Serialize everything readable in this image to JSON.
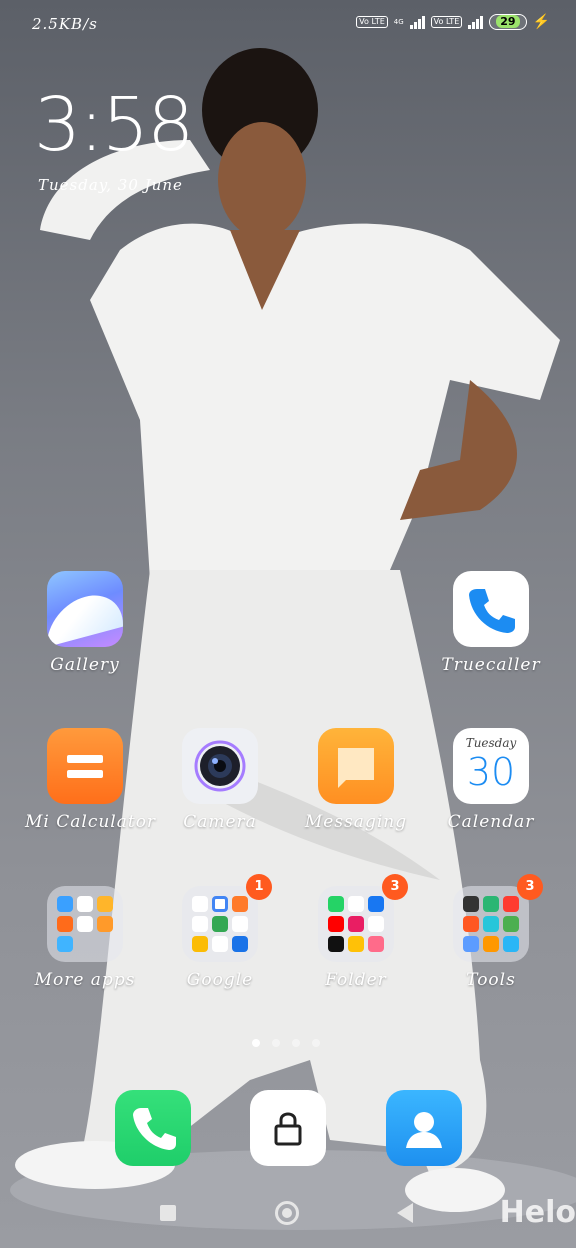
{
  "status_bar": {
    "network_speed": "2.5KB/s",
    "sim1_label": "Vo LTE",
    "network_type": "4G",
    "sim2_label": "Vo LTE",
    "battery_level": "29"
  },
  "lockclock": {
    "time": "3:58",
    "date": "Tuesday, 30 June"
  },
  "apps": {
    "gallery": "Gallery",
    "truecaller": "Truecaller",
    "mi_calculator": "Mi Calculator",
    "camera": "Camera",
    "messaging": "Messaging",
    "calendar": "Calendar",
    "calendar_day": "Tuesday",
    "calendar_date": "30",
    "more_apps": "More apps",
    "google": "Google",
    "google_badge": "1",
    "folder": "Folder",
    "folder_badge": "3",
    "tools": "Tools",
    "tools_badge": "3"
  },
  "page_indicator": {
    "pages": 4,
    "current": 1
  },
  "watermark": "Helo",
  "colors": {
    "accent_badge": "#ff5a1f",
    "phone_green": "#1fce6a",
    "contacts_blue": "#2aa0f0",
    "calc_orange": "#ff7a1f",
    "messaging_orange": "#ffa62b"
  }
}
